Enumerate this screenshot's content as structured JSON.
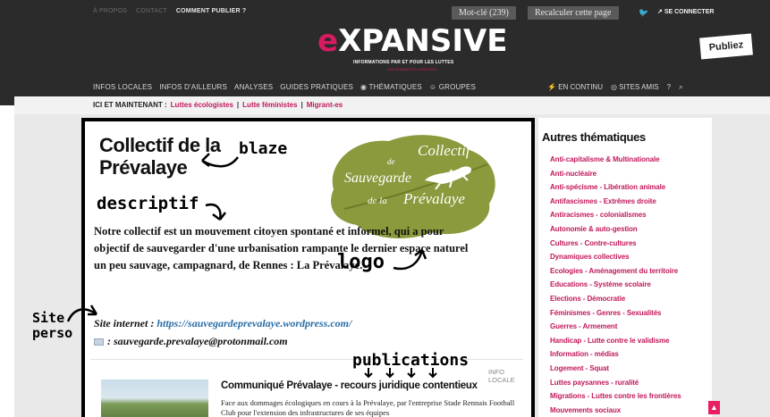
{
  "topbar": {
    "links": [
      "À PROPOS",
      "CONTACT",
      "COMMENT PUBLIER ?"
    ],
    "keyword_button": "Mot-clé (239)",
    "recalc_button": "Recalculer cette page",
    "logout": "SE CONNECTER",
    "publiez": "Publiez"
  },
  "logo": {
    "text_e": "e",
    "text_rest": "XPANSIVE",
    "suffix": ".info",
    "tagline": "INFORMATIONS PAR ET POUR LES LUTTES",
    "tagline2": "DES RENNES ET LA REGION"
  },
  "nav": {
    "items": [
      "INFOS LOCALES",
      "INFOS D'AILLEURS",
      "ANALYSES",
      "GUIDES PRATIQUES",
      "THÉMATIQUES",
      "GROUPES"
    ],
    "right": [
      "EN CONTINU",
      "SITES AMIS",
      "?",
      "Q"
    ]
  },
  "ici": {
    "label": "ICI ET MAINTENANT :",
    "links": [
      "Luttes écologistes",
      "Lutte féministes",
      "Migrant-es"
    ]
  },
  "card": {
    "title": "Collectif de la Prévalaye",
    "description": "Notre collectif est un mouvement citoyen spontané et informel, qui a pour objectif de sauvegarder d'une urbanisation rampante le dernier espace naturel un peu sauvage, campagnard, de Rennes : La Prévalaye.",
    "site_label": "Site internet :",
    "site_url": "https://sauvegardeprevalaye.wordpress.com/",
    "email": ": sauvegarde.prevalaye@protonmail.com",
    "leaf_line1": "Collectif",
    "leaf_line2": "de",
    "leaf_line3": "Sauvegarde",
    "leaf_line4": "de la",
    "leaf_line5": "Prévalaye",
    "infolocale": "INFO LOCALE",
    "pub_title": "Communiqué Prévalaye - recours juridique contentieux",
    "pub_text": "Face aux dommages écologiques en cours à la Prévalaye, par l'entreprise Stade Rennais Football Club pour l'extension des infrastructures de ses équipes"
  },
  "annotations": {
    "blaze": "blaze",
    "descriptif": "descriptif",
    "logo": "logo",
    "site1": "Site",
    "site2": "perso",
    "publications": "publications"
  },
  "sidebar": {
    "title": "Autres thématiques",
    "items": [
      "Anti-capitalisme & Multinationale",
      "Anti-nucléaire",
      "Anti-spécisme - Libération animale",
      "Antifascismes - Extrêmes droite",
      "Antiracismes - colonialismes",
      "Autonomie & auto-gestion",
      "Cultures - Contre-cultures",
      "Dynamiques collectives",
      "Ecologies - Aménagement du territoire",
      "Educations - Système scolaire",
      "Elections - Démocratie",
      "Féminismes - Genres - Sexualités",
      "Guerres - Armement",
      "Handicap - Lutte contre le validisme",
      "Information - médias",
      "Logement - Squat",
      "Luttes paysannes - ruralité",
      "Migrations - Luttes contre les frontières",
      "Mouvements sociaux"
    ]
  },
  "colors": {
    "accent": "#c2185b",
    "header": "#2b2b2b",
    "leaf": "#8a9a3c"
  }
}
